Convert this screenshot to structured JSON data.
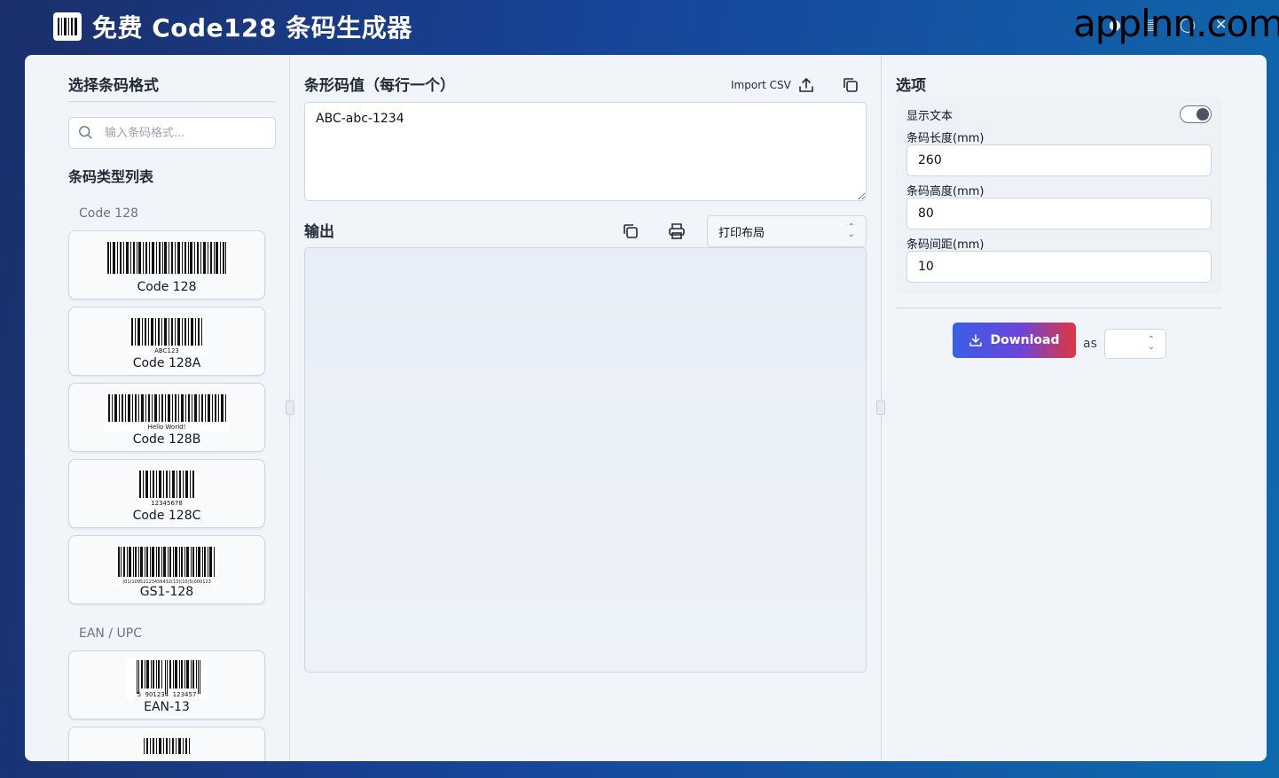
{
  "header": {
    "title": "免费 Code128 条码生成器",
    "brand": "applnn.com"
  },
  "left": {
    "title": "选择条码格式",
    "search_placeholder": "输入条码格式...",
    "list_title": "条码类型列表",
    "groups": [
      {
        "label": "Code 128",
        "items": [
          {
            "name": "Code 128",
            "caption": ""
          },
          {
            "name": "Code 128A",
            "caption": "ABC123"
          },
          {
            "name": "Code 128B",
            "caption": "Hello World!"
          },
          {
            "name": "Code 128C",
            "caption": "12345678"
          },
          {
            "name": "GS1-128",
            "caption": "(01)10952123456432(13)(10)5(000123"
          }
        ]
      },
      {
        "label": "EAN / UPC",
        "items": [
          {
            "name": "EAN-13",
            "caption": "5  901234  123457"
          }
        ]
      }
    ]
  },
  "middle": {
    "input_title": "条形码值（每行一个）",
    "import_label": "Import CSV",
    "input_value": "ABC-abc-1234",
    "output_title": "输出",
    "layout_select": "打印布局"
  },
  "right": {
    "title": "选项",
    "show_text_label": "显示文本",
    "show_text_on": true,
    "length_label": "条码长度(mm)",
    "length_value": "260",
    "height_label": "条码高度(mm)",
    "height_value": "80",
    "spacing_label": "条码间距(mm)",
    "spacing_value": "10",
    "download_label": "Download",
    "as_label": "as",
    "format_value": ""
  }
}
